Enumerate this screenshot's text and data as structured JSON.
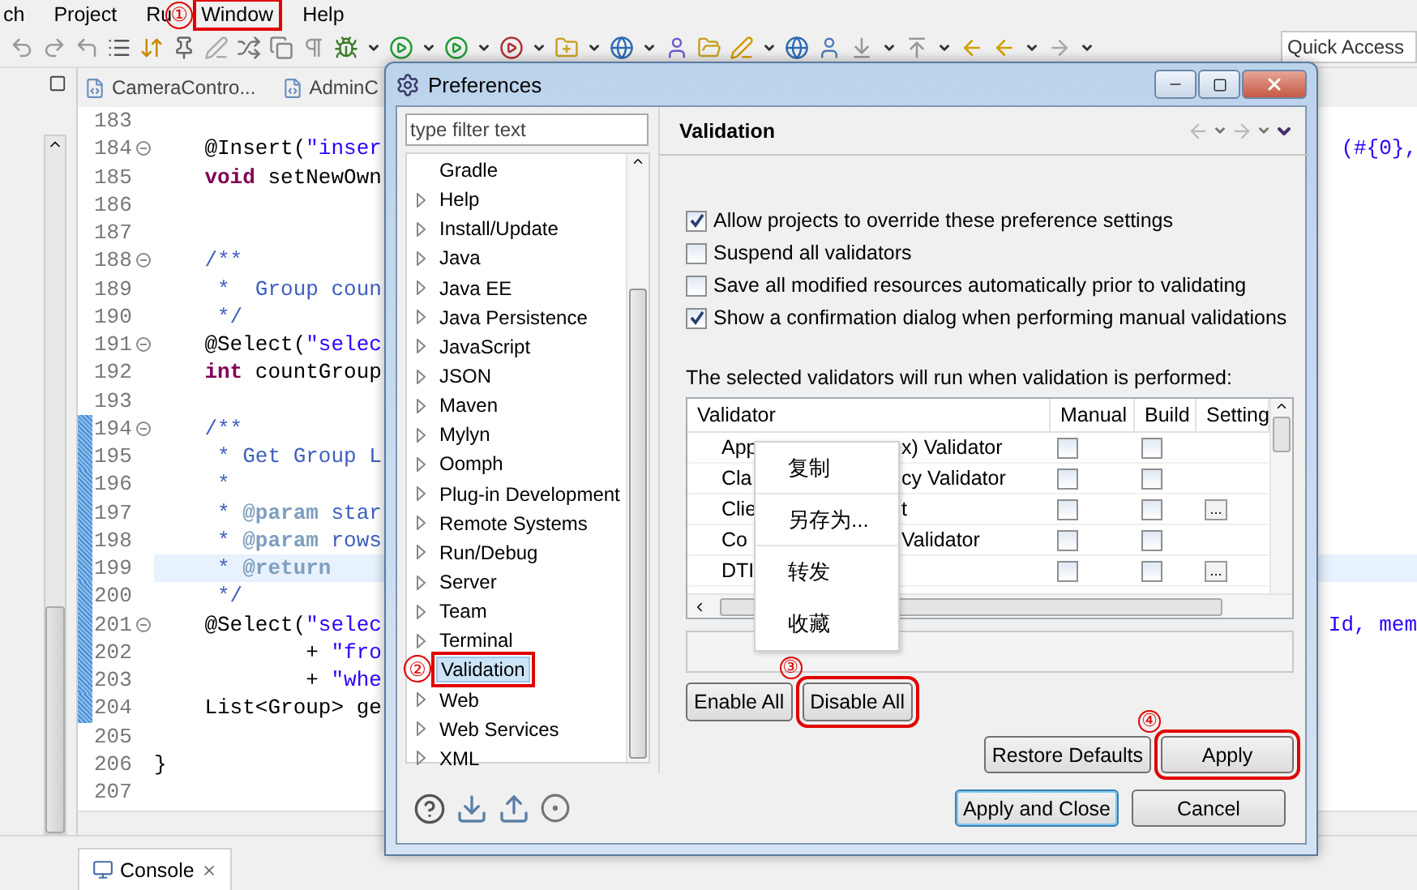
{
  "menu_bar": [
    {
      "label": "ch"
    },
    {
      "label": "Project"
    },
    {
      "label": "Ru"
    },
    {
      "label": "Window",
      "callout": "①"
    },
    {
      "label": "Help"
    }
  ],
  "quick_access": {
    "placeholder": "Quick Access"
  },
  "editor_tabs": [
    {
      "label": "CameraContro..."
    },
    {
      "label": "AdminC"
    }
  ],
  "code_lines": [
    {
      "number": "183",
      "fold": false,
      "changed": false,
      "current": false
    },
    {
      "number": "184",
      "fold": true,
      "changed": false,
      "current": false,
      "tokens": [
        {
          "text": "    @Insert(",
          "kind": "plain"
        },
        {
          "text": "\"inser",
          "kind": "string"
        }
      ],
      "overflow": "(#{0},"
    },
    {
      "number": "185",
      "fold": false,
      "changed": false,
      "current": false,
      "tokens": [
        {
          "text": "    void",
          "kind": "keyword"
        },
        {
          "text": " setNewOwn",
          "kind": "plain"
        }
      ]
    },
    {
      "number": "186",
      "fold": false,
      "changed": false,
      "current": false
    },
    {
      "number": "187",
      "fold": false,
      "changed": false,
      "current": false
    },
    {
      "number": "188",
      "fold": true,
      "changed": false,
      "current": false,
      "tokens": [
        {
          "text": "    /**",
          "kind": "comment"
        }
      ]
    },
    {
      "number": "189",
      "fold": false,
      "changed": false,
      "current": false,
      "tokens": [
        {
          "text": "     *  Group coun",
          "kind": "comment"
        }
      ]
    },
    {
      "number": "190",
      "fold": false,
      "changed": false,
      "current": false,
      "tokens": [
        {
          "text": "     */",
          "kind": "comment"
        }
      ]
    },
    {
      "number": "191",
      "fold": true,
      "changed": false,
      "current": false,
      "tokens": [
        {
          "text": "    @Select(",
          "kind": "plain"
        },
        {
          "text": "\"selec",
          "kind": "string"
        }
      ]
    },
    {
      "number": "192",
      "fold": false,
      "changed": false,
      "current": false,
      "tokens": [
        {
          "text": "    int",
          "kind": "keyword"
        },
        {
          "text": " countGroup",
          "kind": "plain"
        }
      ]
    },
    {
      "number": "193",
      "fold": false,
      "changed": false,
      "current": false
    },
    {
      "number": "194",
      "fold": true,
      "changed": true,
      "current": false,
      "tokens": [
        {
          "text": "    /**",
          "kind": "comment"
        }
      ]
    },
    {
      "number": "195",
      "fold": false,
      "changed": true,
      "current": false,
      "tokens": [
        {
          "text": "     * Get Group L",
          "kind": "comment"
        }
      ]
    },
    {
      "number": "196",
      "fold": false,
      "changed": true,
      "current": false,
      "tokens": [
        {
          "text": "     *",
          "kind": "comment"
        }
      ]
    },
    {
      "number": "197",
      "fold": false,
      "changed": true,
      "current": false,
      "tokens": [
        {
          "text": "     * ",
          "kind": "comment"
        },
        {
          "text": "@param",
          "kind": "tag"
        },
        {
          "text": " star",
          "kind": "comment"
        }
      ]
    },
    {
      "number": "198",
      "fold": false,
      "changed": true,
      "current": false,
      "tokens": [
        {
          "text": "     * ",
          "kind": "comment"
        },
        {
          "text": "@param",
          "kind": "tag"
        },
        {
          "text": " rows",
          "kind": "comment"
        }
      ]
    },
    {
      "number": "199",
      "fold": false,
      "changed": true,
      "current": true,
      "tokens": [
        {
          "text": "     * ",
          "kind": "comment"
        },
        {
          "text": "@return",
          "kind": "tag"
        }
      ]
    },
    {
      "number": "200",
      "fold": false,
      "changed": true,
      "current": false,
      "tokens": [
        {
          "text": "     */",
          "kind": "comment"
        }
      ]
    },
    {
      "number": "201",
      "fold": true,
      "changed": true,
      "current": false,
      "tokens": [
        {
          "text": "    @Select(",
          "kind": "plain"
        },
        {
          "text": "\"selec",
          "kind": "string"
        }
      ],
      "overflow": "Id, mem"
    },
    {
      "number": "202",
      "fold": false,
      "changed": true,
      "current": false,
      "tokens": [
        {
          "text": "            + ",
          "kind": "plain"
        },
        {
          "text": "\"fro",
          "kind": "string"
        }
      ]
    },
    {
      "number": "203",
      "fold": false,
      "changed": true,
      "current": false,
      "tokens": [
        {
          "text": "            + ",
          "kind": "plain"
        },
        {
          "text": "\"whe",
          "kind": "string"
        }
      ]
    },
    {
      "number": "204",
      "fold": false,
      "changed": true,
      "current": false,
      "tokens": [
        {
          "text": "    List<Group> ge",
          "kind": "plain"
        }
      ]
    },
    {
      "number": "205",
      "fold": false,
      "changed": false,
      "current": false
    },
    {
      "number": "206",
      "fold": false,
      "changed": false,
      "current": false,
      "tokens": [
        {
          "text": "}",
          "kind": "plain"
        }
      ]
    },
    {
      "number": "207",
      "fold": false,
      "changed": false,
      "current": false
    }
  ],
  "console_tab": {
    "label": "Console"
  },
  "dialog": {
    "title": "Preferences",
    "filter": {
      "placeholder": "type filter text"
    },
    "tree": [
      {
        "label": "Gradle",
        "expandable": false,
        "selected": false
      },
      {
        "label": "Help",
        "expandable": true,
        "selected": false
      },
      {
        "label": "Install/Update",
        "expandable": true,
        "selected": false
      },
      {
        "label": "Java",
        "expandable": true,
        "selected": false
      },
      {
        "label": "Java EE",
        "expandable": true,
        "selected": false
      },
      {
        "label": "Java Persistence",
        "expandable": true,
        "selected": false
      },
      {
        "label": "JavaScript",
        "expandable": true,
        "selected": false
      },
      {
        "label": "JSON",
        "expandable": true,
        "selected": false
      },
      {
        "label": "Maven",
        "expandable": true,
        "selected": false
      },
      {
        "label": "Mylyn",
        "expandable": true,
        "selected": false
      },
      {
        "label": "Oomph",
        "expandable": true,
        "selected": false
      },
      {
        "label": "Plug-in Development",
        "expandable": true,
        "selected": false
      },
      {
        "label": "Remote Systems",
        "expandable": true,
        "selected": false
      },
      {
        "label": "Run/Debug",
        "expandable": true,
        "selected": false
      },
      {
        "label": "Server",
        "expandable": true,
        "selected": false
      },
      {
        "label": "Team",
        "expandable": true,
        "selected": false
      },
      {
        "label": "Terminal",
        "expandable": true,
        "selected": false
      },
      {
        "label": "Validation",
        "expandable": false,
        "selected": true,
        "callout": "②"
      },
      {
        "label": "Web",
        "expandable": true,
        "selected": false
      },
      {
        "label": "Web Services",
        "expandable": true,
        "selected": false
      },
      {
        "label": "XML",
        "expandable": true,
        "selected": false
      }
    ],
    "page_title": "Validation",
    "options": [
      {
        "label": "Allow projects to override these preference settings",
        "checked": true
      },
      {
        "label": "Suspend all validators",
        "checked": false
      },
      {
        "label": "Save all modified resources automatically prior to validating",
        "checked": false
      },
      {
        "label": "Show a confirmation dialog when performing manual validations",
        "checked": true
      }
    ],
    "validators_label": "The selected validators will run when validation is performed:",
    "table": {
      "columns": [
        "Validator",
        "Manual",
        "Build",
        "Setting"
      ],
      "rows": [
        {
          "name_parts": [
            "App",
            "x) Validator"
          ],
          "manual": false,
          "build": false
        },
        {
          "name_parts": [
            "Cla",
            "cy Validator"
          ],
          "manual": false,
          "build": false
        },
        {
          "name_parts": [
            "Clie",
            "t"
          ],
          "manual": false,
          "build": false,
          "setting": "..."
        },
        {
          "name_parts": [
            "Co",
            "Validator"
          ],
          "manual": false,
          "build": false
        },
        {
          "name_parts": [
            "DTI"
          ],
          "manual": false,
          "build": false,
          "setting": "..."
        }
      ]
    },
    "table_buttons": [
      {
        "label": "Enable All"
      },
      {
        "label": "Disable All",
        "callout": "③"
      }
    ],
    "page_buttons": [
      {
        "label": "Restore Defaults"
      },
      {
        "label": "Apply",
        "callout": "④"
      }
    ],
    "footer_buttons": [
      {
        "label": "Apply and Close",
        "default": true
      },
      {
        "label": "Cancel",
        "default": false
      }
    ]
  },
  "context_menu": [
    {
      "label": "复制",
      "separator_after": true
    },
    {
      "label": "另存为...",
      "separator_after": true
    },
    {
      "label": "转发",
      "separator_after": false
    },
    {
      "label": "收藏",
      "separator_after": false
    }
  ]
}
